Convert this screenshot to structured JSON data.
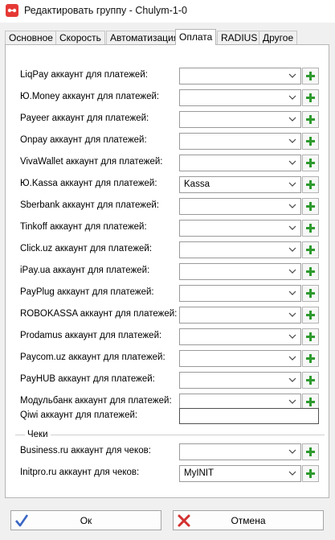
{
  "window": {
    "title": "Редактировать группу - Chulym-1-0"
  },
  "tabs": [
    {
      "label": "Основное",
      "active": false
    },
    {
      "label": "Скорость",
      "active": false
    },
    {
      "label": "Автоматизация",
      "active": false
    },
    {
      "label": "Оплата",
      "active": true
    },
    {
      "label": "RADIUS",
      "active": false
    },
    {
      "label": "Другое",
      "active": false
    }
  ],
  "payment_accounts": [
    {
      "label": "LiqPay аккаунт для платежей:",
      "value": ""
    },
    {
      "label": "Ю.Money аккаунт для платежей:",
      "value": ""
    },
    {
      "label": "Payeer аккаунт для платежей:",
      "value": ""
    },
    {
      "label": "Onpay аккаунт для платежей:",
      "value": ""
    },
    {
      "label": "VivaWallet аккаунт для платежей:",
      "value": ""
    },
    {
      "label": "Ю.Kassa аккаунт для платежей:",
      "value": "Kassa"
    },
    {
      "label": "Sberbank аккаунт для платежей:",
      "value": ""
    },
    {
      "label": "Tinkoff аккаунт для платежей:",
      "value": ""
    },
    {
      "label": "Click.uz аккаунт для платежей:",
      "value": ""
    },
    {
      "label": "iPay.ua аккаунт для платежей:",
      "value": ""
    },
    {
      "label": "PayPlug аккаунт для платежей:",
      "value": ""
    },
    {
      "label": "ROBOKASSA аккаунт для платежей:",
      "value": ""
    },
    {
      "label": "Prodamus аккаунт для платежей:",
      "value": ""
    },
    {
      "label": "Paycom.uz аккаунт для платежей:",
      "value": ""
    },
    {
      "label": "PayHUB аккаунт для платежей:",
      "value": ""
    },
    {
      "label": "Модульбанк аккаунт для платежей:",
      "value": ""
    }
  ],
  "qiwi": {
    "label": "Qiwi аккаунт для платежей:",
    "value": ""
  },
  "receipts": {
    "group_title": "Чеки",
    "items": [
      {
        "label": "Business.ru аккаунт для чеков:",
        "value": ""
      },
      {
        "label": "Initpro.ru аккаунт для чеков:",
        "value": "MyINIT"
      }
    ]
  },
  "buttons": {
    "ok": "Ок",
    "cancel": "Отмена"
  },
  "colors": {
    "add_icon": "#2e9a2e",
    "ok_check": "#3a66c4",
    "cancel_x": "#d32f2f",
    "app_icon": "#e53935"
  }
}
